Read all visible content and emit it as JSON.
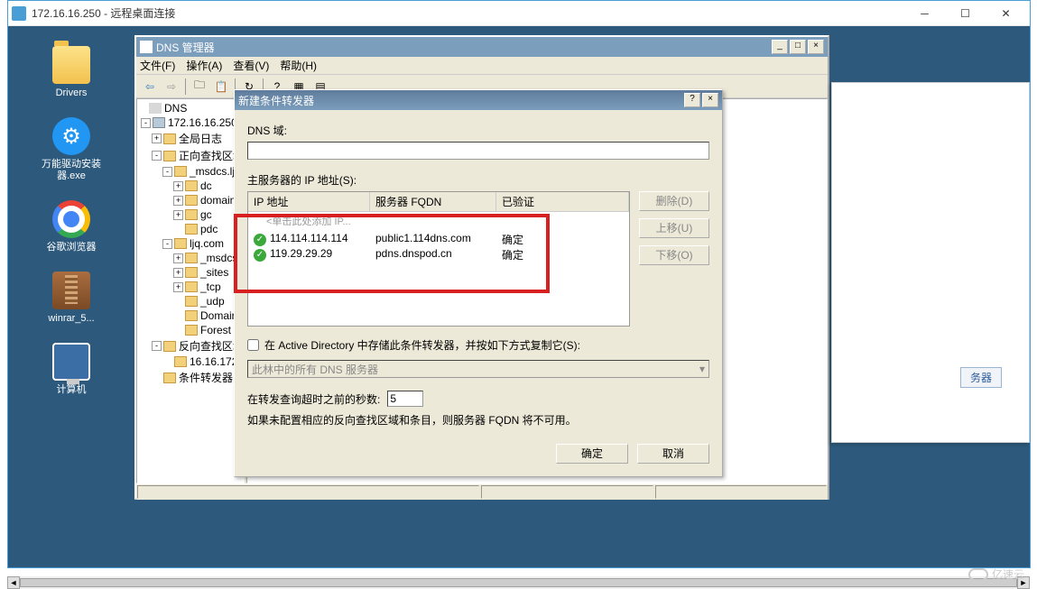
{
  "rdp": {
    "title": "172.16.16.250 - 远程桌面连接"
  },
  "desktop": {
    "icons": [
      {
        "label": "Drivers"
      },
      {
        "label": "万能驱动安装器.exe"
      },
      {
        "label": "谷歌浏览器"
      },
      {
        "label": "winrar_5..."
      },
      {
        "label": "计算机"
      }
    ]
  },
  "dns_manager": {
    "title": "DNS 管理器",
    "menus": {
      "file": "文件(F)",
      "action": "操作(A)",
      "view": "查看(V)",
      "help": "帮助(H)"
    },
    "tree": {
      "root": "DNS",
      "server": "172.16.16.250",
      "nodes": [
        "全局日志",
        "正向查找区域",
        "_msdcs.lj",
        "dc",
        "domain",
        "gc",
        "pdc",
        "ljq.com",
        "_msdcs",
        "_sites",
        "_tcp",
        "_udp",
        "Domain",
        "Forest",
        "反向查找区域",
        "16.16.172",
        "条件转发器"
      ]
    }
  },
  "right_panel": {
    "button": "务器"
  },
  "dialog": {
    "title": "新建条件转发器",
    "dns_domain_label": "DNS 域:",
    "dns_domain_value": "",
    "master_label": "主服务器的 IP 地址(S):",
    "columns": {
      "ip": "IP 地址",
      "fqdn": "服务器 FQDN",
      "validated": "已验证"
    },
    "placeholder_row": "<单击此处添加 IP...",
    "rows": [
      {
        "ip": "114.114.114.114",
        "fqdn": "public1.114dns.com",
        "validated": "确定"
      },
      {
        "ip": "119.29.29.29",
        "fqdn": "pdns.dnspod.cn",
        "validated": "确定"
      }
    ],
    "buttons": {
      "delete": "删除(D)",
      "up": "上移(U)",
      "down": "下移(O)"
    },
    "store_in_ad": "在 Active Directory 中存储此条件转发器，并按如下方式复制它(S):",
    "replication_scope": "此林中的所有 DNS 服务器",
    "timeout_label": "在转发查询超时之前的秒数:",
    "timeout_value": "5",
    "note": "如果未配置相应的反向查找区域和条目，则服务器 FQDN 将不可用。",
    "ok": "确定",
    "cancel": "取消"
  },
  "watermark": "亿速云"
}
